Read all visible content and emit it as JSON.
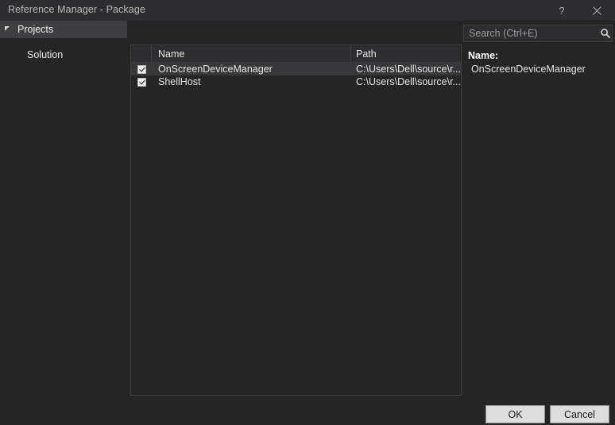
{
  "window": {
    "title": "Reference Manager - Package",
    "help_label": "?",
    "close_label": "✕"
  },
  "sidebar": {
    "items": [
      {
        "label": "Projects",
        "expanded": true,
        "selected": true
      },
      {
        "label": "Solution",
        "expanded": false,
        "selected": false
      }
    ]
  },
  "search": {
    "placeholder": "Search (Ctrl+E)",
    "value": "",
    "icon": "search-icon",
    "dropdown_icon": "chevron-down-icon"
  },
  "list": {
    "columns": [
      "",
      "Name",
      "Path"
    ],
    "rows": [
      {
        "checked": true,
        "name": "OnScreenDeviceManager",
        "path": "C:\\Users\\Dell\\source\\r...",
        "selected": true
      },
      {
        "checked": true,
        "name": "ShellHost",
        "path": "C:\\Users\\Dell\\source\\r...",
        "selected": false
      }
    ]
  },
  "details": {
    "name_label": "Name:",
    "name_value": "OnScreenDeviceManager"
  },
  "footer": {
    "ok_label": "OK",
    "cancel_label": "Cancel"
  },
  "colors": {
    "dialog_bg": "#252526",
    "titlebar_bg": "#2d2d30",
    "panel_border": "#3e3e40",
    "selection_bg": "#37373a",
    "tree_selection_bg": "#3f3f41",
    "text_primary": "#f1f1f1",
    "text_muted": "#9d9d9d",
    "button_bg": "#dddddd"
  }
}
